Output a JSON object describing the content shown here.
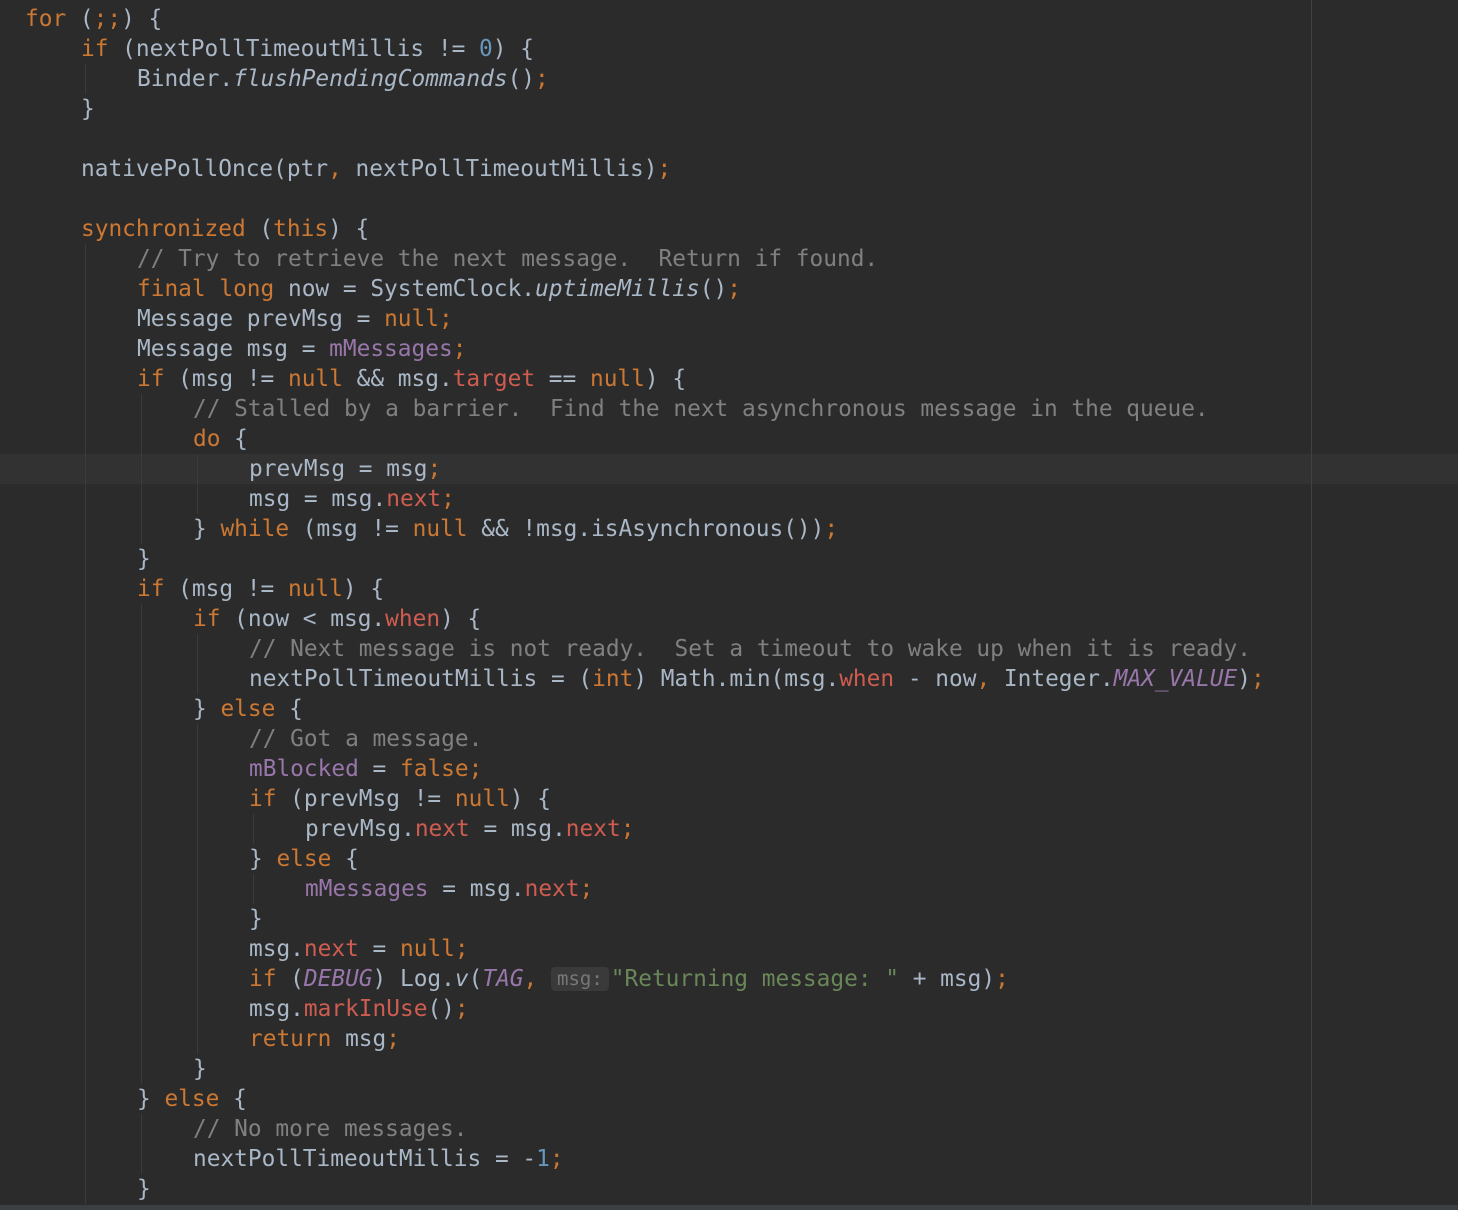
{
  "editor": {
    "background": "#2b2b2b",
    "colors": {
      "keyword": "#cc7832",
      "number": "#6897bb",
      "comment": "#808080",
      "field": "#9876aa",
      "member": "#cf5c50",
      "string": "#6a8759",
      "default": "#a9b7c6"
    },
    "lines": [
      {
        "indent": 0,
        "tokens": [
          {
            "t": "for",
            "c": "kw"
          },
          {
            "t": " ("
          },
          {
            "t": ";;",
            "c": "kw"
          },
          {
            "t": ") {"
          }
        ]
      },
      {
        "indent": 1,
        "tokens": [
          {
            "t": "if",
            "c": "kw"
          },
          {
            "t": " (nextPollTimeoutMillis != "
          },
          {
            "t": "0",
            "c": "num"
          },
          {
            "t": ") {"
          }
        ]
      },
      {
        "indent": 2,
        "tokens": [
          {
            "t": "Binder."
          },
          {
            "t": "flushPendingCommands",
            "c": "it"
          },
          {
            "t": "()"
          },
          {
            "t": ";",
            "c": "kw"
          }
        ]
      },
      {
        "indent": 1,
        "tokens": [
          {
            "t": "}"
          }
        ]
      },
      {
        "indent": 0,
        "tokens": []
      },
      {
        "indent": 1,
        "tokens": [
          {
            "t": "nativePollOnce(ptr"
          },
          {
            "t": ",",
            "c": "kw"
          },
          {
            "t": " nextPollTimeoutMillis)"
          },
          {
            "t": ";",
            "c": "kw"
          }
        ]
      },
      {
        "indent": 0,
        "tokens": []
      },
      {
        "indent": 1,
        "tokens": [
          {
            "t": "synchronized",
            "c": "kw"
          },
          {
            "t": " ("
          },
          {
            "t": "this",
            "c": "kw"
          },
          {
            "t": ") {"
          }
        ]
      },
      {
        "indent": 2,
        "tokens": [
          {
            "t": "// Try to retrieve the next message.  Return if found.",
            "c": "cm"
          }
        ]
      },
      {
        "indent": 2,
        "tokens": [
          {
            "t": "final long",
            "c": "kw"
          },
          {
            "t": " now = SystemClock."
          },
          {
            "t": "uptimeMillis",
            "c": "it"
          },
          {
            "t": "()"
          },
          {
            "t": ";",
            "c": "kw"
          }
        ]
      },
      {
        "indent": 2,
        "tokens": [
          {
            "t": "Message prevMsg = "
          },
          {
            "t": "null;",
            "c": "kw"
          }
        ]
      },
      {
        "indent": 2,
        "tokens": [
          {
            "t": "Message msg = "
          },
          {
            "t": "mMessages",
            "c": "fld"
          },
          {
            "t": ";",
            "c": "kw"
          }
        ]
      },
      {
        "indent": 2,
        "tokens": [
          {
            "t": "if",
            "c": "kw"
          },
          {
            "t": " (msg != "
          },
          {
            "t": "null",
            "c": "kw"
          },
          {
            "t": " && msg."
          },
          {
            "t": "target",
            "c": "red"
          },
          {
            "t": " == "
          },
          {
            "t": "null",
            "c": "kw"
          },
          {
            "t": ") {"
          }
        ]
      },
      {
        "indent": 3,
        "tokens": [
          {
            "t": "// Stalled by a barrier.  Find the next asynchronous message in the queue.",
            "c": "cm"
          }
        ]
      },
      {
        "indent": 3,
        "tokens": [
          {
            "t": "do",
            "c": "kw"
          },
          {
            "t": " {"
          }
        ]
      },
      {
        "indent": 4,
        "tokens": [
          {
            "t": "prevMsg = msg"
          },
          {
            "t": ";",
            "c": "kw"
          }
        ]
      },
      {
        "indent": 4,
        "tokens": [
          {
            "t": "msg = msg."
          },
          {
            "t": "next",
            "c": "red"
          },
          {
            "t": ";",
            "c": "kw"
          }
        ]
      },
      {
        "indent": 3,
        "tokens": [
          {
            "t": "} "
          },
          {
            "t": "while",
            "c": "kw"
          },
          {
            "t": " (msg != "
          },
          {
            "t": "null",
            "c": "kw"
          },
          {
            "t": " && !msg.isAsynchronous())"
          },
          {
            "t": ";",
            "c": "kw"
          }
        ]
      },
      {
        "indent": 2,
        "tokens": [
          {
            "t": "}"
          }
        ]
      },
      {
        "indent": 2,
        "tokens": [
          {
            "t": "if",
            "c": "kw"
          },
          {
            "t": " (msg != "
          },
          {
            "t": "null",
            "c": "kw"
          },
          {
            "t": ") {"
          }
        ]
      },
      {
        "indent": 3,
        "tokens": [
          {
            "t": "if",
            "c": "kw"
          },
          {
            "t": " (now < msg."
          },
          {
            "t": "when",
            "c": "red"
          },
          {
            "t": ") {"
          }
        ]
      },
      {
        "indent": 4,
        "tokens": [
          {
            "t": "// Next message is not ready.  Set a timeout to wake up when it is ready.",
            "c": "cm"
          }
        ]
      },
      {
        "indent": 4,
        "tokens": [
          {
            "t": "nextPollTimeoutMillis = ("
          },
          {
            "t": "int",
            "c": "kw"
          },
          {
            "t": ") Math.min(msg."
          },
          {
            "t": "when",
            "c": "red"
          },
          {
            "t": " - now"
          },
          {
            "t": ",",
            "c": "kw"
          },
          {
            "t": " Integer."
          },
          {
            "t": "MAX_VALUE",
            "c": "fld it"
          },
          {
            "t": ")"
          },
          {
            "t": ";",
            "c": "kw"
          }
        ]
      },
      {
        "indent": 3,
        "tokens": [
          {
            "t": "} "
          },
          {
            "t": "else",
            "c": "kw"
          },
          {
            "t": " {"
          }
        ]
      },
      {
        "indent": 4,
        "tokens": [
          {
            "t": "// Got a message.",
            "c": "cm"
          }
        ]
      },
      {
        "indent": 4,
        "tokens": [
          {
            "t": "mBlocked",
            "c": "fld"
          },
          {
            "t": " = "
          },
          {
            "t": "false;",
            "c": "kw"
          }
        ]
      },
      {
        "indent": 4,
        "tokens": [
          {
            "t": "if",
            "c": "kw"
          },
          {
            "t": " (prevMsg != "
          },
          {
            "t": "null",
            "c": "kw"
          },
          {
            "t": ") {"
          }
        ]
      },
      {
        "indent": 5,
        "tokens": [
          {
            "t": "prevMsg."
          },
          {
            "t": "next",
            "c": "red"
          },
          {
            "t": " = msg."
          },
          {
            "t": "next",
            "c": "red"
          },
          {
            "t": ";",
            "c": "kw"
          }
        ]
      },
      {
        "indent": 4,
        "tokens": [
          {
            "t": "} "
          },
          {
            "t": "else",
            "c": "kw"
          },
          {
            "t": " {"
          }
        ]
      },
      {
        "indent": 5,
        "tokens": [
          {
            "t": "mMessages",
            "c": "fld"
          },
          {
            "t": " = msg."
          },
          {
            "t": "next",
            "c": "red"
          },
          {
            "t": ";",
            "c": "kw"
          }
        ]
      },
      {
        "indent": 4,
        "tokens": [
          {
            "t": "}"
          }
        ]
      },
      {
        "indent": 4,
        "tokens": [
          {
            "t": "msg."
          },
          {
            "t": "next",
            "c": "red"
          },
          {
            "t": " = "
          },
          {
            "t": "null;",
            "c": "kw"
          }
        ]
      },
      {
        "indent": 4,
        "tokens": [
          {
            "t": "if",
            "c": "kw"
          },
          {
            "t": " ("
          },
          {
            "t": "DEBUG",
            "c": "fld it"
          },
          {
            "t": ") Log."
          },
          {
            "t": "v",
            "c": "it"
          },
          {
            "t": "("
          },
          {
            "t": "TAG",
            "c": "fld it"
          },
          {
            "t": ", ",
            "c": "kw"
          },
          {
            "t": "msg:",
            "c": "hint"
          },
          {
            "t": "\"Returning message: \"",
            "c": "str"
          },
          {
            "t": " + msg)"
          },
          {
            "t": ";",
            "c": "kw"
          }
        ]
      },
      {
        "indent": 4,
        "tokens": [
          {
            "t": "msg."
          },
          {
            "t": "markInUse",
            "c": "red"
          },
          {
            "t": "()"
          },
          {
            "t": ";",
            "c": "kw"
          }
        ]
      },
      {
        "indent": 4,
        "tokens": [
          {
            "t": "return",
            "c": "kw"
          },
          {
            "t": " msg"
          },
          {
            "t": ";",
            "c": "kw"
          }
        ]
      },
      {
        "indent": 3,
        "tokens": [
          {
            "t": "}"
          }
        ]
      },
      {
        "indent": 2,
        "tokens": [
          {
            "t": "} "
          },
          {
            "t": "else",
            "c": "kw"
          },
          {
            "t": " {"
          }
        ]
      },
      {
        "indent": 3,
        "tokens": [
          {
            "t": "// No more messages.",
            "c": "cm"
          }
        ]
      },
      {
        "indent": 3,
        "tokens": [
          {
            "t": "nextPollTimeoutMillis = -"
          },
          {
            "t": "1",
            "c": "num"
          },
          {
            "t": ";",
            "c": "kw"
          }
        ]
      },
      {
        "indent": 2,
        "tokens": [
          {
            "t": "}"
          }
        ]
      }
    ]
  }
}
